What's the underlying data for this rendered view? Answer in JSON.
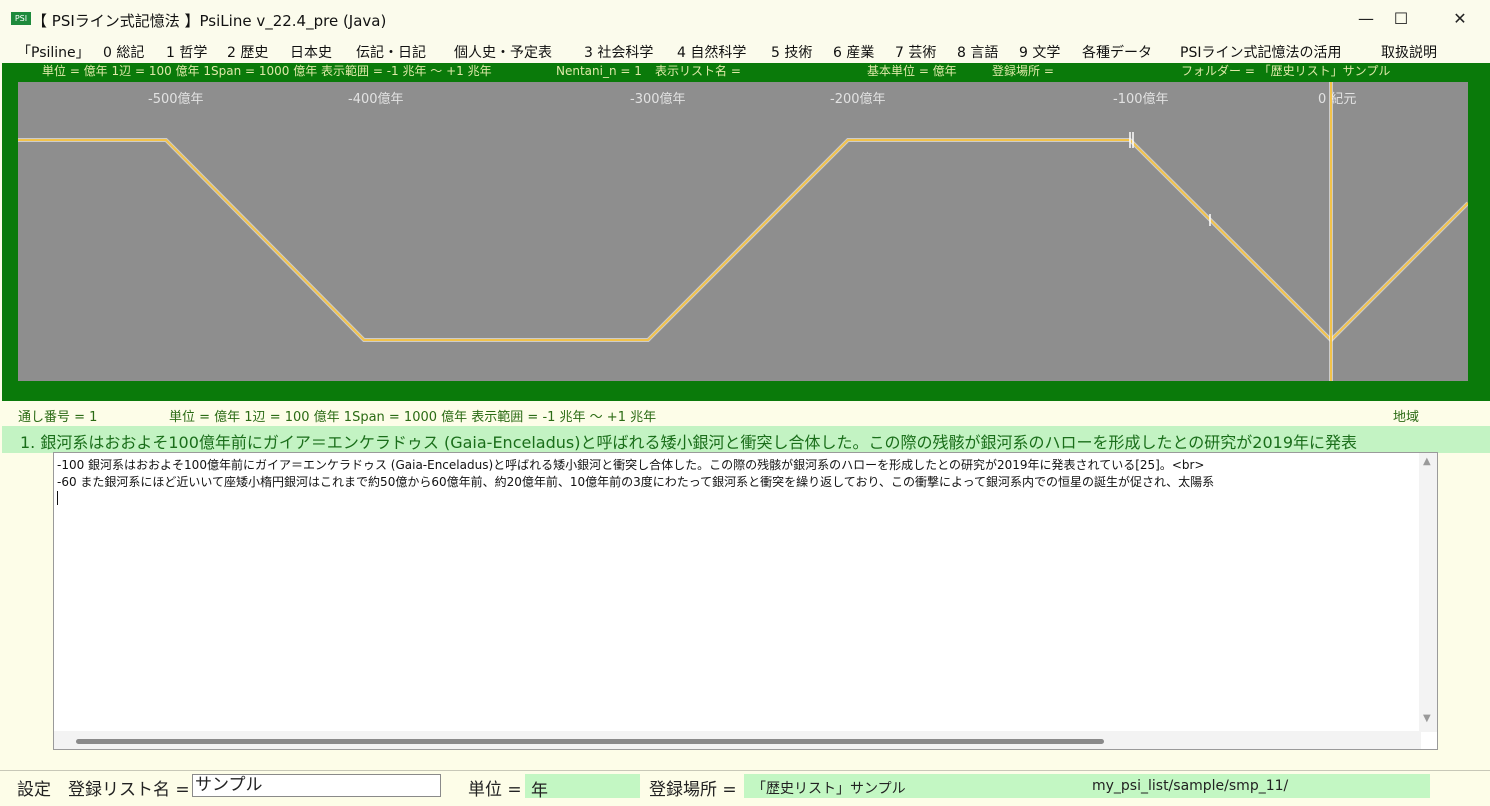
{
  "window": {
    "icon_text": "PSI",
    "title": "【 PSIライン式記憶法 】PsiLine v_22.4_pre (Java)",
    "minimize_glyph": "—",
    "maximize_glyph": "☐",
    "close_glyph": "✕"
  },
  "menu": [
    "「Psiline」",
    "0 総記",
    "1 哲学",
    "2 歴史",
    "日本史",
    "伝記・日記",
    "個人史・予定表",
    "3 社会科学",
    "4 自然科学",
    "5 技術",
    "6 産業",
    "7 芸術",
    "8 言語",
    "9 文学",
    "各種データ",
    "PSIライン式記憶法の活用",
    "取扱説明"
  ],
  "info_bar": {
    "units": "単位 = 億年  1辺 = 100 億年  1Span = 1000 億年  表示範囲 = -1 兆年 〜 +1 兆年",
    "nentani": "Nentani_n = 1",
    "list_name": "表示リスト名 =",
    "base_unit": "基本単位 = 億年",
    "location": "登録場所 =",
    "folder": "フォルダー = 「歴史リスト」サンプル"
  },
  "axis_ticks": [
    "-500億年",
    "-400億年",
    "-300億年",
    "-200億年",
    "-100億年",
    "0 紀元"
  ],
  "status": {
    "serial": "通し番号 = 1",
    "units": "単位 = 億年  1辺 = 100 億年  1Span = 1000 億年  表示範囲 = -1 兆年 〜 +1 兆年",
    "region": "地域"
  },
  "event_line": "1. 銀河系はおおよそ100億年前にガイア＝エンケラドゥス (Gaia-Enceladus)と呼ばれる矮小銀河と衝突し合体した。この際の残骸が銀河系のハローを形成したとの研究が2019年に発表",
  "text_lines": [
    "-100  銀河系はおおよそ100億年前にガイア＝エンケラドゥス (Gaia-Enceladus)と呼ばれる矮小銀河と衝突し合体した。この際の残骸が銀河系のハローを形成したとの研究が2019年に発表されている[25]。<br>",
    "-60  また銀河系にほど近いいて座矮小楕円銀河はこれまで約50億から60億年前、約20億年前、10億年前の3度にわたって銀河系と衝突を繰り返しており、この衝撃によって銀河系内での恒星の誕生が促され、太陽系"
  ],
  "bottom": {
    "settings": "設定",
    "list_label": "登録リスト名 =",
    "list_value": "サンプル",
    "unit_label": "単位 =",
    "unit_value": "年",
    "location_label": "登録場所 =",
    "location_value": "「歴史リスト」サンプル",
    "path": "my_psi_list/sample/smp_11/"
  },
  "colors": {
    "frame": "#0a7a0a",
    "plot_bg": "#8e8e8e",
    "timeline": "#f3c34a",
    "event_bg": "#c3f3c3"
  }
}
